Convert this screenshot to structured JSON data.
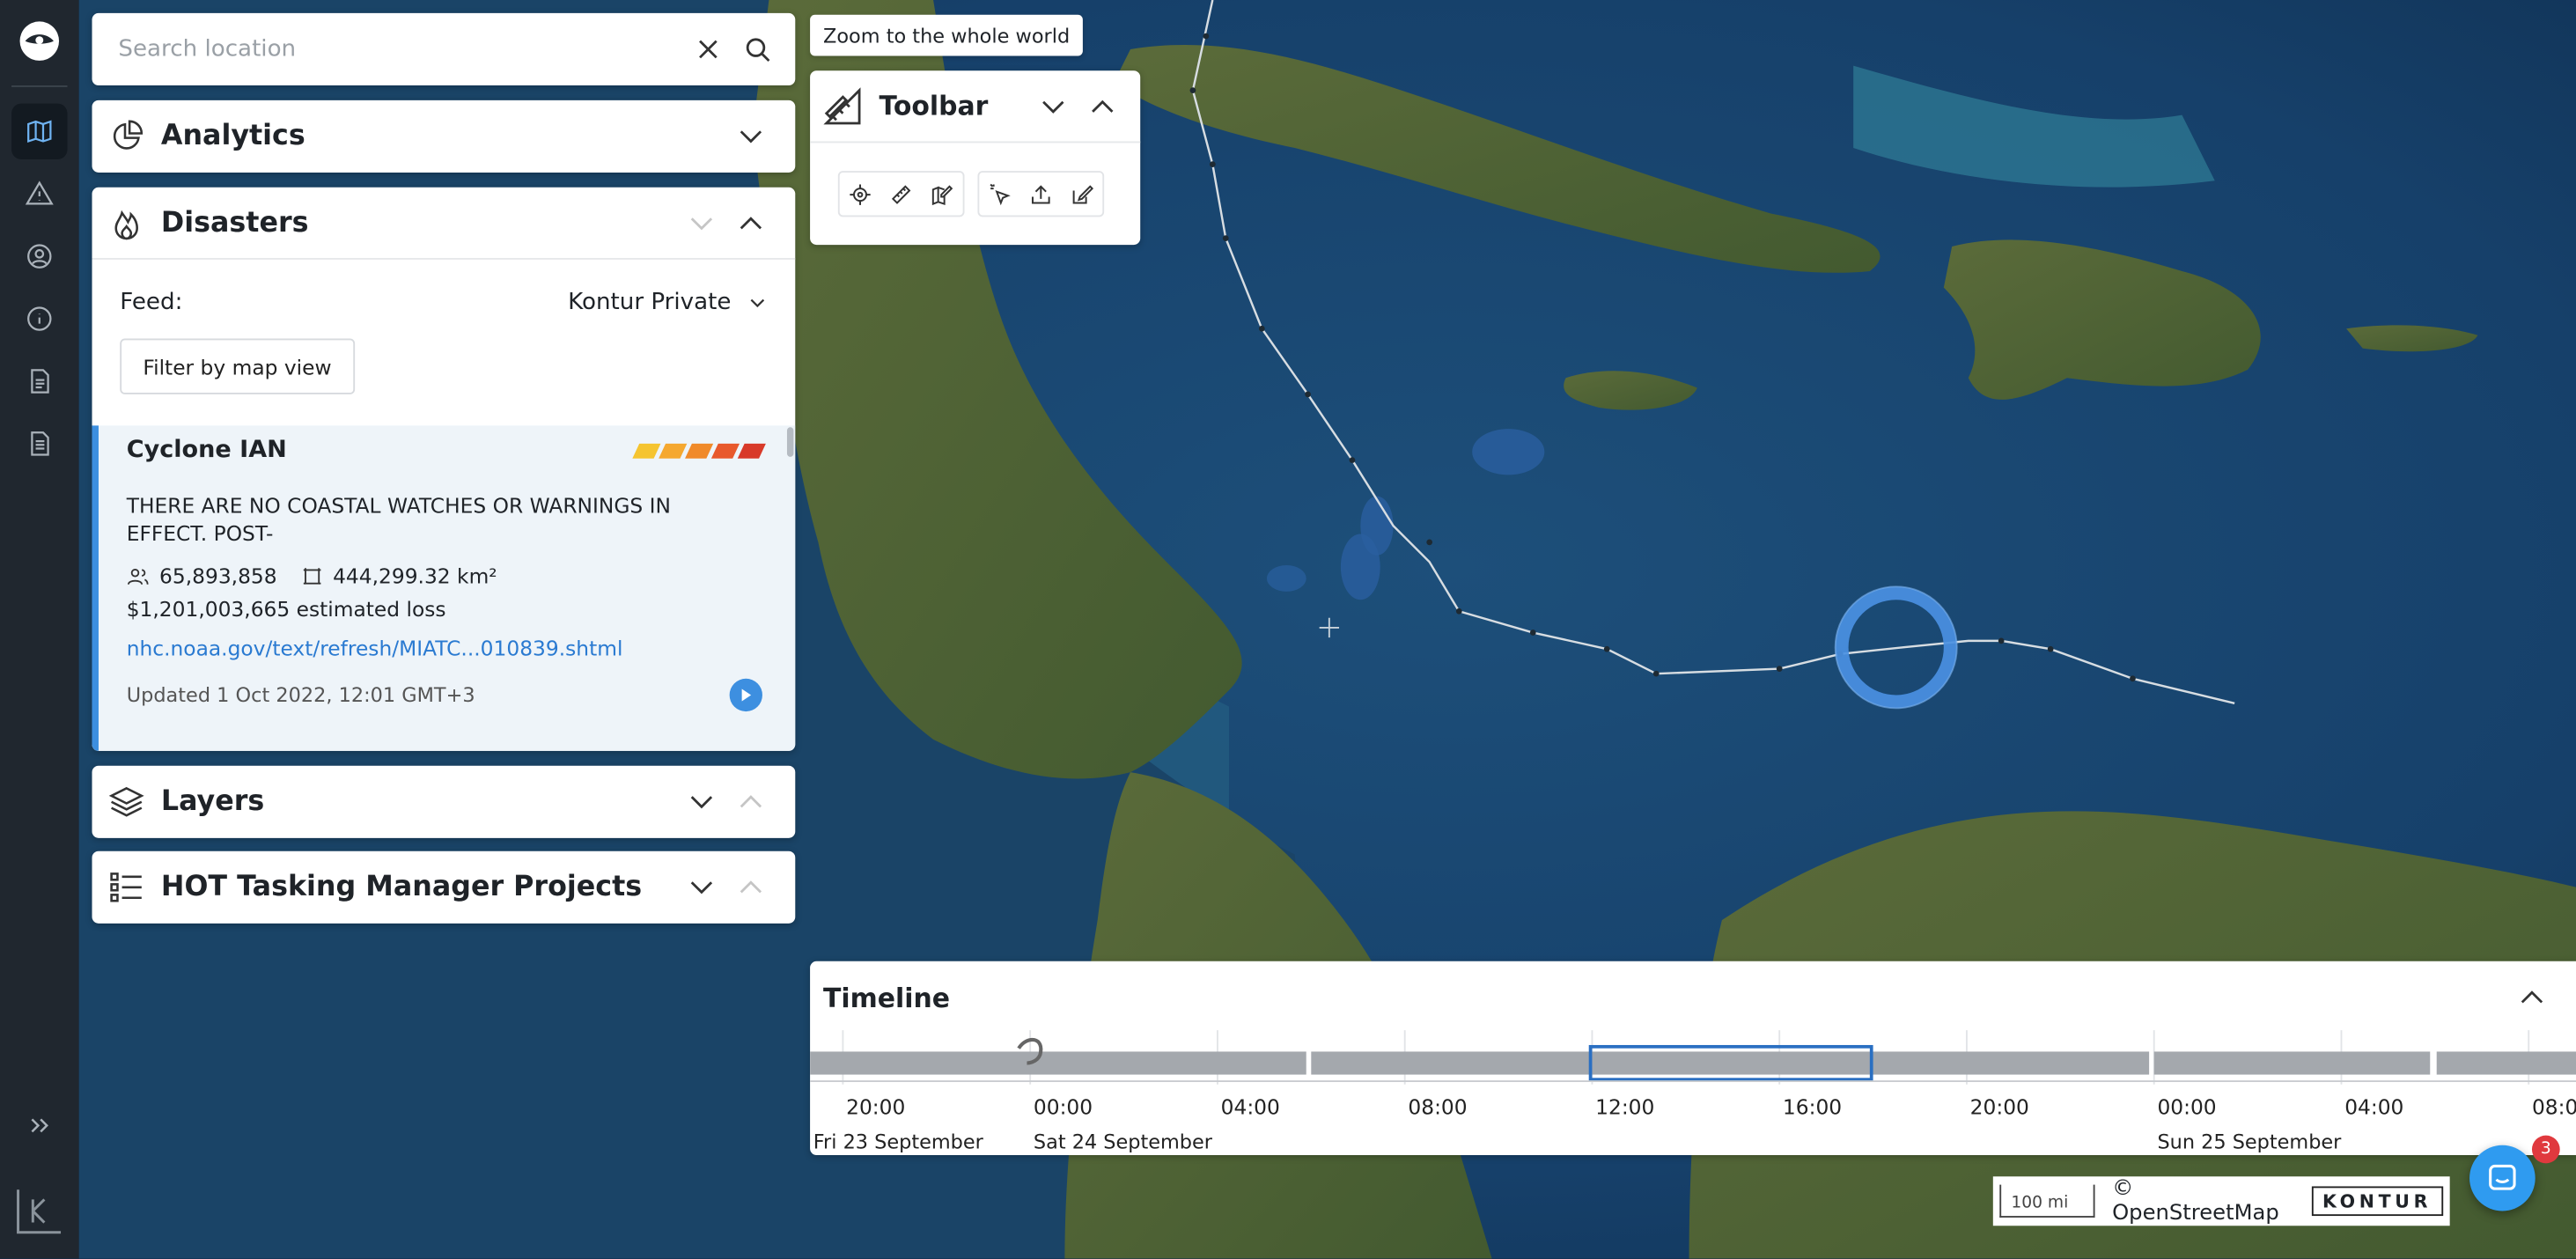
{
  "search": {
    "placeholder": "Search location"
  },
  "analytics": {
    "title": "Analytics"
  },
  "disasters": {
    "title": "Disasters",
    "feed_label": "Feed:",
    "feed_value": "Kontur Private",
    "filter_button": "Filter by map view",
    "event": {
      "name": "Cyclone IAN",
      "severity_colors": [
        "#f5c430",
        "#f5a830",
        "#f08a2a",
        "#e8592c",
        "#d83a2a"
      ],
      "description": "THERE ARE NO COASTAL WATCHES OR WARNINGS IN EFFECT. POST-",
      "population": "65,893,858",
      "area": "444,299.32 km²",
      "loss": "$1,201,003,665 estimated loss",
      "link": "nhc.noaa.gov/text/refresh/MIATC...010839.shtml",
      "updated": "Updated 1 Oct 2022, 12:01 GMT+3"
    }
  },
  "layers": {
    "title": "Layers"
  },
  "hot": {
    "title": "HOT Tasking Manager Projects"
  },
  "toolbar": {
    "zoom_tooltip": "Zoom to the whole world",
    "title": "Toolbar",
    "tools_group_1": [
      "locate-icon",
      "ruler-icon",
      "edit-map-icon"
    ],
    "tools_group_2": [
      "select-icon",
      "upload-icon",
      "draw-icon"
    ]
  },
  "timeline": {
    "title": "Timeline",
    "ticks": [
      "20:00",
      "00:00",
      "04:00",
      "08:00",
      "12:00",
      "16:00",
      "20:00",
      "00:00",
      "04:00",
      "08:0"
    ],
    "day_labels": [
      "Fri 23 September",
      "Sat 24 September",
      "Sun 25 September"
    ]
  },
  "attribution": {
    "scale": "100 mi",
    "osm": "© OpenStreetMap",
    "logo": "KONTUR"
  },
  "chat": {
    "badge": "3"
  },
  "colors": {
    "accent": "#3d8fe0",
    "rail": "#20272f",
    "hurricane_ring": "#4a90e2"
  }
}
